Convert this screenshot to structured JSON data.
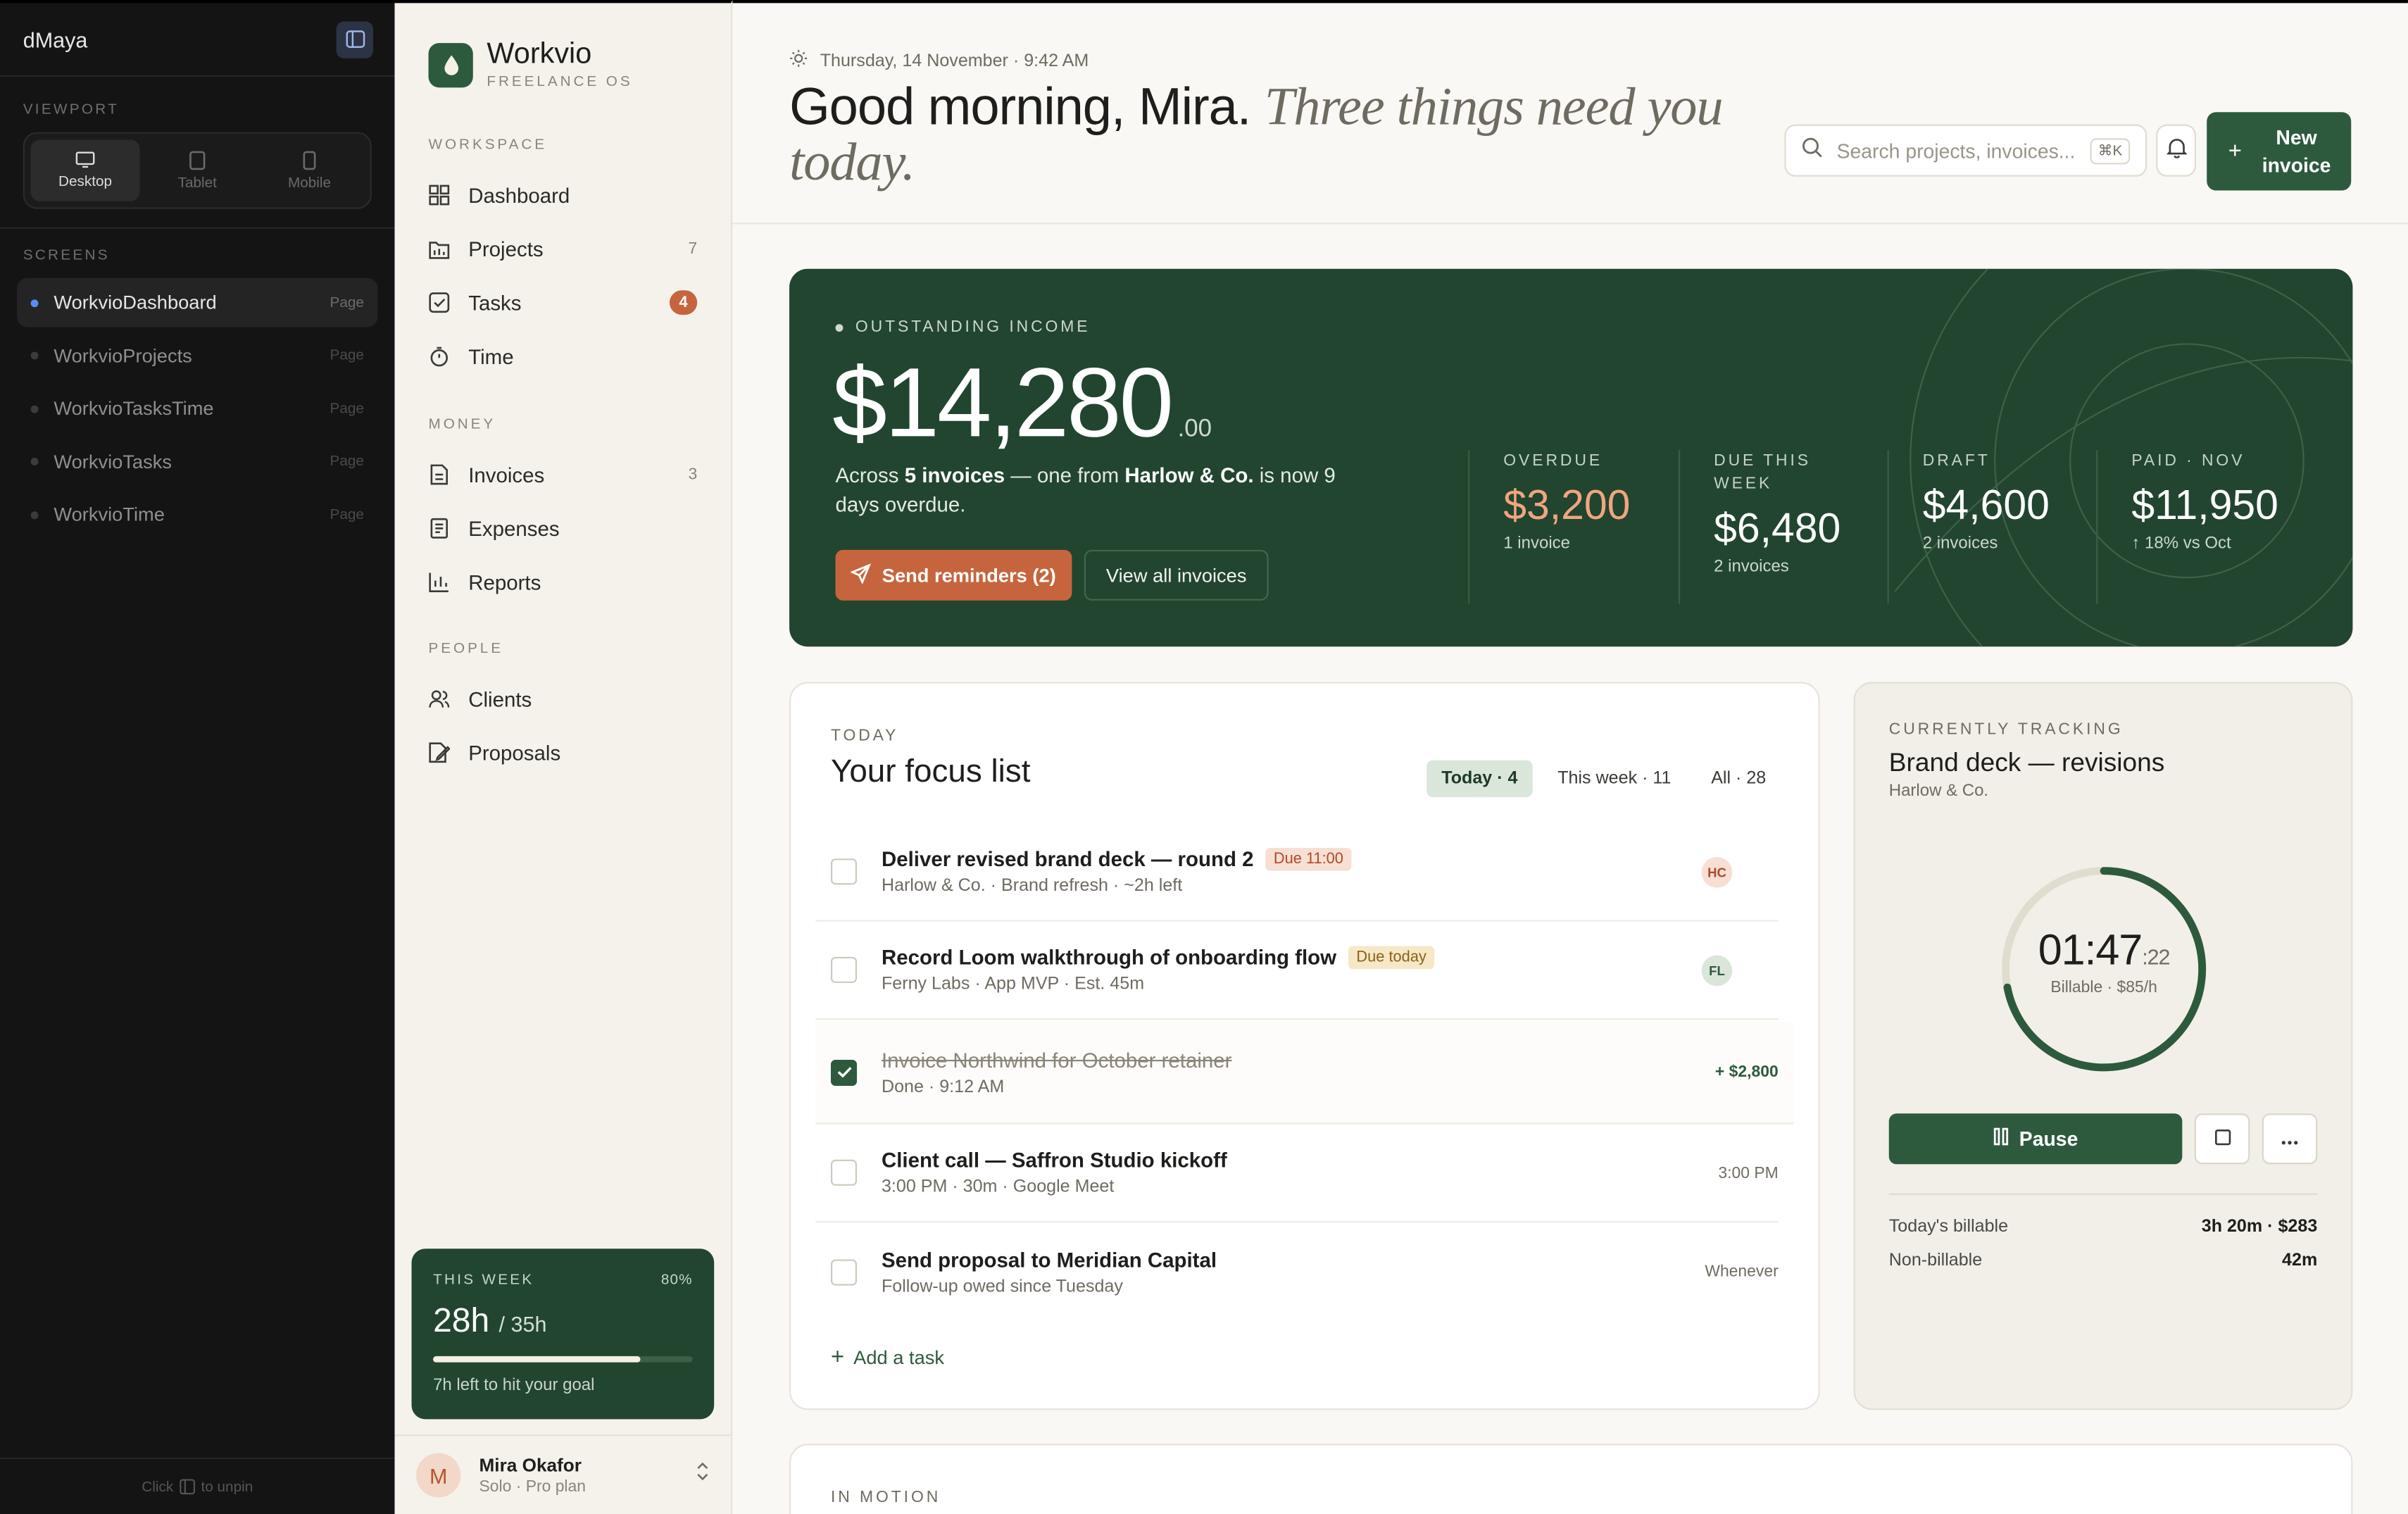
{
  "dev_panel": {
    "title": "dMaya",
    "viewport_label": "VIEWPORT",
    "viewports": [
      {
        "label": "Desktop",
        "active": true
      },
      {
        "label": "Tablet",
        "active": false
      },
      {
        "label": "Mobile",
        "active": false
      }
    ],
    "screens_label": "SCREENS",
    "screens": [
      {
        "name": "WorkvioDashboard",
        "tag": "Page",
        "active": true
      },
      {
        "name": "WorkvioProjects",
        "tag": "Page",
        "active": false
      },
      {
        "name": "WorkvioTasksTime",
        "tag": "Page",
        "active": false
      },
      {
        "name": "WorkvioTasks",
        "tag": "Page",
        "active": false
      },
      {
        "name": "WorkvioTime",
        "tag": "Page",
        "active": false
      }
    ],
    "footer_click": "Click",
    "footer_unpin": "to unpin"
  },
  "sidebar": {
    "brand": "Workvio",
    "brand_sub": "FREELANCE OS",
    "groups": {
      "workspace": "WORKSPACE",
      "money": "MONEY",
      "people": "PEOPLE"
    },
    "items": [
      {
        "label": "Dashboard",
        "icon": "dashboard-icon",
        "count": ""
      },
      {
        "label": "Projects",
        "icon": "folder-icon",
        "count": "7"
      },
      {
        "label": "Tasks",
        "icon": "checkbox-icon",
        "count": "4"
      },
      {
        "label": "Time",
        "icon": "stopwatch-icon",
        "count": ""
      },
      {
        "label": "Invoices",
        "icon": "invoice-icon",
        "count": "3"
      },
      {
        "label": "Expenses",
        "icon": "receipt-icon",
        "count": ""
      },
      {
        "label": "Reports",
        "icon": "bar-chart-icon",
        "count": ""
      },
      {
        "label": "Clients",
        "icon": "users-icon",
        "count": ""
      },
      {
        "label": "Proposals",
        "icon": "proposal-icon",
        "count": ""
      }
    ],
    "week": {
      "label": "THIS WEEK",
      "percent_label": "80%",
      "progress": 0.8,
      "hours": "28h",
      "target": "/ 35h",
      "footnote": "7h left to hit your goal"
    },
    "user": {
      "initial": "M",
      "name": "Mira Okafor",
      "plan": "Solo · Pro plan"
    }
  },
  "header": {
    "date": "Thursday, 14 November · 9:42 AM",
    "greeting": "Good morning, Mira.",
    "greeting_sub": "Three things need you today.",
    "search_placeholder": "Search projects, invoices...",
    "search_shortcut": "⌘K",
    "new_invoice": "New invoice"
  },
  "income": {
    "label": "OUTSTANDING INCOME",
    "amount": "$14,280",
    "cents": ".00",
    "desc_pre": "Across ",
    "desc_count": "5 invoices",
    "desc_mid": " — one from ",
    "desc_client": "Harlow & Co.",
    "desc_post": " is now 9 days overdue.",
    "send_reminders": "Send reminders (2)",
    "view_all": "View all invoices",
    "stats": [
      {
        "label": "OVERDUE",
        "value": "$3,200",
        "sub": "1 invoice",
        "color": "#f0a580"
      },
      {
        "label": "DUE THIS WEEK",
        "value": "$6,480",
        "sub": "2 invoices",
        "color": "#ffffff"
      },
      {
        "label": "DRAFT",
        "value": "$4,600",
        "sub": "2 invoices",
        "color": "#ffffff"
      },
      {
        "label": "PAID · NOV",
        "value": "$11,950",
        "sub": "↑ 18% vs Oct",
        "color": "#ffffff"
      }
    ]
  },
  "focus": {
    "label": "TODAY",
    "title": "Your focus list",
    "tabs": [
      "Today · 4",
      "This week · 11",
      "All · 28"
    ],
    "tasks": [
      {
        "title": "Deliver revised brand deck — round 2",
        "chip": "Due 11:00",
        "meta": "Harlow & Co. · Brand refresh · ~2h left",
        "right": "HC",
        "done": false
      },
      {
        "title": "Record Loom walkthrough of onboarding flow",
        "chip": "Due today",
        "meta": "Ferny Labs · App MVP · Est. 45m",
        "right": "FL",
        "done": false
      },
      {
        "title": "Invoice Northwind for October retainer",
        "chip": "",
        "meta": "Done · 9:12 AM",
        "right": "+ $2,800",
        "done": true
      },
      {
        "title": "Client call — Saffron Studio kickoff",
        "chip": "",
        "meta": "3:00 PM · 30m · Google Meet",
        "right": "3:00 PM",
        "done": false
      },
      {
        "title": "Send proposal to Meridian Capital",
        "chip": "",
        "meta": "Follow-up owed since Tuesday",
        "right": "Whenever",
        "done": false
      }
    ],
    "add_task": "Add a task"
  },
  "tracking": {
    "label": "CURRENTLY TRACKING",
    "title": "Brand deck — revisions",
    "client": "Harlow & Co.",
    "time": "01:47",
    "seconds": ":22",
    "rate": "Billable · $85/h",
    "progress": 0.72,
    "pause": "Pause",
    "rows": [
      {
        "key": "Today's billable",
        "value": "3h 20m · $283"
      },
      {
        "key": "Non-billable",
        "value": "42m"
      }
    ]
  },
  "motion": {
    "label": "IN MOTION"
  },
  "colors": {
    "brand_green": "#2d5a3d",
    "hero_green": "#22452f",
    "accent_orange": "#c6653d",
    "overdue": "#f0a580"
  }
}
